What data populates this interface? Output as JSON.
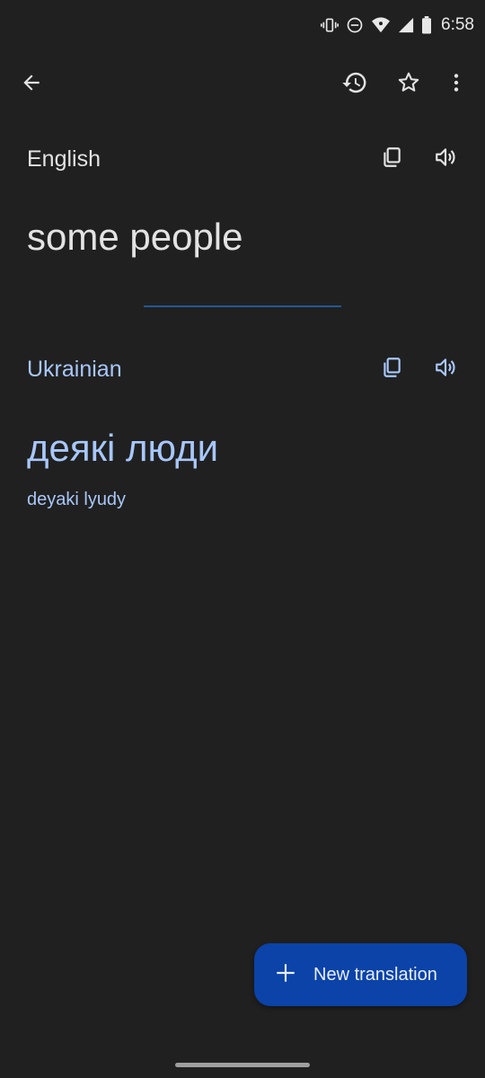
{
  "status_bar": {
    "time": "6:58",
    "icons": [
      "vibrate-icon",
      "do-not-disturb-icon",
      "wifi-icon",
      "signal-icon",
      "battery-icon"
    ]
  },
  "toolbar": {
    "back_icon": "arrow-back-icon",
    "history_icon": "history-icon",
    "star_icon": "star-outline-icon",
    "more_icon": "more-vert-icon"
  },
  "source": {
    "language": "English",
    "text": "some people",
    "copy_icon": "copy-icon",
    "speak_icon": "volume-icon"
  },
  "target": {
    "language": "Ukrainian",
    "text": "деякі люди",
    "transliteration": "deyaki lyudy",
    "copy_icon": "copy-icon",
    "speak_icon": "volume-icon"
  },
  "fab": {
    "label": "New translation",
    "icon": "plus-icon"
  },
  "colors": {
    "background": "#202020",
    "source_text": "#e3e3e3",
    "target_text": "#a8c7fa",
    "fab": "#0b43a8",
    "divider": "#1f5a96"
  }
}
